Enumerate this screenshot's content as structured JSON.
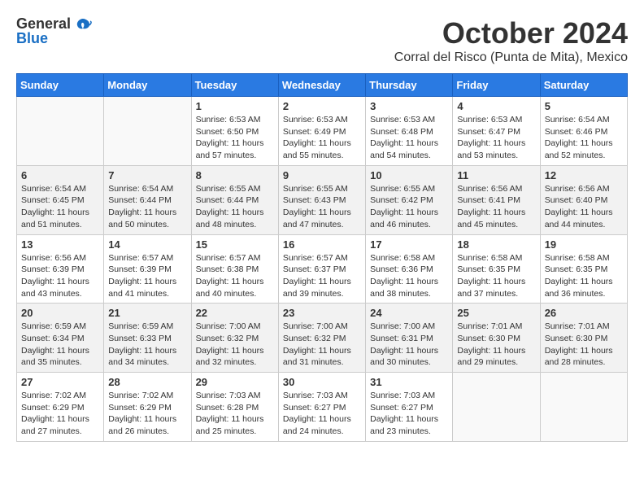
{
  "header": {
    "logo_line1": "General",
    "logo_line2": "Blue",
    "month": "October 2024",
    "location": "Corral del Risco (Punta de Mita), Mexico"
  },
  "weekdays": [
    "Sunday",
    "Monday",
    "Tuesday",
    "Wednesday",
    "Thursday",
    "Friday",
    "Saturday"
  ],
  "weeks": [
    [
      {
        "day": "",
        "info": ""
      },
      {
        "day": "",
        "info": ""
      },
      {
        "day": "1",
        "info": "Sunrise: 6:53 AM\nSunset: 6:50 PM\nDaylight: 11 hours and 57 minutes."
      },
      {
        "day": "2",
        "info": "Sunrise: 6:53 AM\nSunset: 6:49 PM\nDaylight: 11 hours and 55 minutes."
      },
      {
        "day": "3",
        "info": "Sunrise: 6:53 AM\nSunset: 6:48 PM\nDaylight: 11 hours and 54 minutes."
      },
      {
        "day": "4",
        "info": "Sunrise: 6:53 AM\nSunset: 6:47 PM\nDaylight: 11 hours and 53 minutes."
      },
      {
        "day": "5",
        "info": "Sunrise: 6:54 AM\nSunset: 6:46 PM\nDaylight: 11 hours and 52 minutes."
      }
    ],
    [
      {
        "day": "6",
        "info": "Sunrise: 6:54 AM\nSunset: 6:45 PM\nDaylight: 11 hours and 51 minutes."
      },
      {
        "day": "7",
        "info": "Sunrise: 6:54 AM\nSunset: 6:44 PM\nDaylight: 11 hours and 50 minutes."
      },
      {
        "day": "8",
        "info": "Sunrise: 6:55 AM\nSunset: 6:44 PM\nDaylight: 11 hours and 48 minutes."
      },
      {
        "day": "9",
        "info": "Sunrise: 6:55 AM\nSunset: 6:43 PM\nDaylight: 11 hours and 47 minutes."
      },
      {
        "day": "10",
        "info": "Sunrise: 6:55 AM\nSunset: 6:42 PM\nDaylight: 11 hours and 46 minutes."
      },
      {
        "day": "11",
        "info": "Sunrise: 6:56 AM\nSunset: 6:41 PM\nDaylight: 11 hours and 45 minutes."
      },
      {
        "day": "12",
        "info": "Sunrise: 6:56 AM\nSunset: 6:40 PM\nDaylight: 11 hours and 44 minutes."
      }
    ],
    [
      {
        "day": "13",
        "info": "Sunrise: 6:56 AM\nSunset: 6:39 PM\nDaylight: 11 hours and 43 minutes."
      },
      {
        "day": "14",
        "info": "Sunrise: 6:57 AM\nSunset: 6:39 PM\nDaylight: 11 hours and 41 minutes."
      },
      {
        "day": "15",
        "info": "Sunrise: 6:57 AM\nSunset: 6:38 PM\nDaylight: 11 hours and 40 minutes."
      },
      {
        "day": "16",
        "info": "Sunrise: 6:57 AM\nSunset: 6:37 PM\nDaylight: 11 hours and 39 minutes."
      },
      {
        "day": "17",
        "info": "Sunrise: 6:58 AM\nSunset: 6:36 PM\nDaylight: 11 hours and 38 minutes."
      },
      {
        "day": "18",
        "info": "Sunrise: 6:58 AM\nSunset: 6:35 PM\nDaylight: 11 hours and 37 minutes."
      },
      {
        "day": "19",
        "info": "Sunrise: 6:58 AM\nSunset: 6:35 PM\nDaylight: 11 hours and 36 minutes."
      }
    ],
    [
      {
        "day": "20",
        "info": "Sunrise: 6:59 AM\nSunset: 6:34 PM\nDaylight: 11 hours and 35 minutes."
      },
      {
        "day": "21",
        "info": "Sunrise: 6:59 AM\nSunset: 6:33 PM\nDaylight: 11 hours and 34 minutes."
      },
      {
        "day": "22",
        "info": "Sunrise: 7:00 AM\nSunset: 6:32 PM\nDaylight: 11 hours and 32 minutes."
      },
      {
        "day": "23",
        "info": "Sunrise: 7:00 AM\nSunset: 6:32 PM\nDaylight: 11 hours and 31 minutes."
      },
      {
        "day": "24",
        "info": "Sunrise: 7:00 AM\nSunset: 6:31 PM\nDaylight: 11 hours and 30 minutes."
      },
      {
        "day": "25",
        "info": "Sunrise: 7:01 AM\nSunset: 6:30 PM\nDaylight: 11 hours and 29 minutes."
      },
      {
        "day": "26",
        "info": "Sunrise: 7:01 AM\nSunset: 6:30 PM\nDaylight: 11 hours and 28 minutes."
      }
    ],
    [
      {
        "day": "27",
        "info": "Sunrise: 7:02 AM\nSunset: 6:29 PM\nDaylight: 11 hours and 27 minutes."
      },
      {
        "day": "28",
        "info": "Sunrise: 7:02 AM\nSunset: 6:29 PM\nDaylight: 11 hours and 26 minutes."
      },
      {
        "day": "29",
        "info": "Sunrise: 7:03 AM\nSunset: 6:28 PM\nDaylight: 11 hours and 25 minutes."
      },
      {
        "day": "30",
        "info": "Sunrise: 7:03 AM\nSunset: 6:27 PM\nDaylight: 11 hours and 24 minutes."
      },
      {
        "day": "31",
        "info": "Sunrise: 7:03 AM\nSunset: 6:27 PM\nDaylight: 11 hours and 23 minutes."
      },
      {
        "day": "",
        "info": ""
      },
      {
        "day": "",
        "info": ""
      }
    ]
  ]
}
